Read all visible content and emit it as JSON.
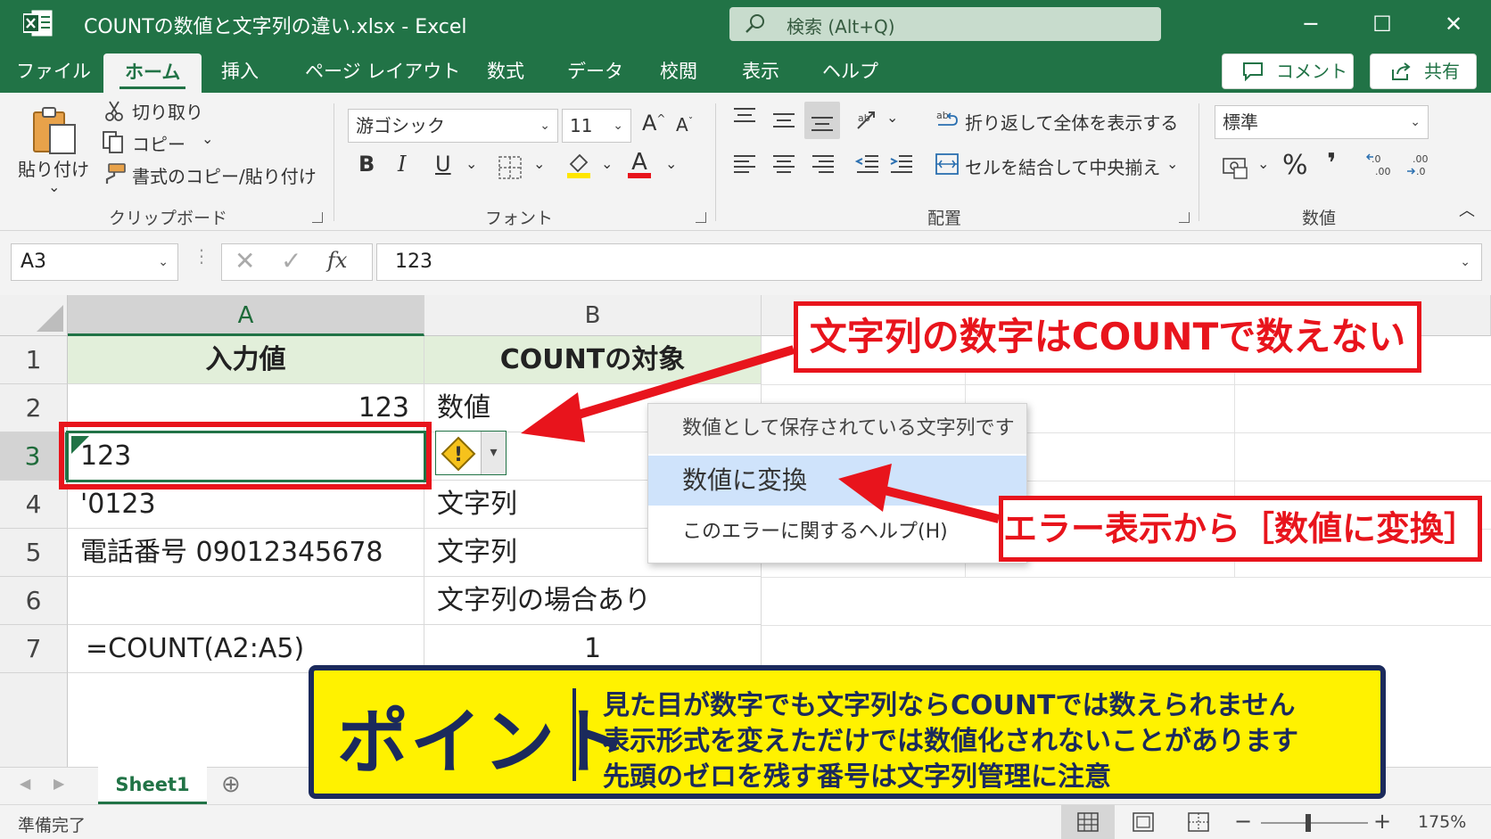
{
  "window": {
    "title": "COUNTの数値と文字列の違い.xlsx  -  Excel",
    "search_placeholder": "検索 (Alt+Q)",
    "minimize": "─",
    "maximize": "☐",
    "close": "✕"
  },
  "tabs": [
    "ファイル",
    "ホーム",
    "挿入",
    "ページ レイアウト",
    "数式",
    "データ",
    "校閲",
    "表示",
    "ヘルプ"
  ],
  "active_tab": "ホーム",
  "header_buttons": {
    "comment": "コメント",
    "share": "共有"
  },
  "ribbon": {
    "clipboard": {
      "paste": "貼り付け",
      "cut": "切り取り",
      "copy": "コピー",
      "format_painter": "書式のコピー/貼り付け",
      "label": "クリップボード"
    },
    "font": {
      "font_name": "游ゴシック",
      "font_size": "11",
      "bold": "B",
      "italic": "I",
      "underline": "U",
      "label": "フォント"
    },
    "alignment": {
      "wrap_text": "折り返して全体を表示する",
      "merge_center": "セルを結合して中央揃え",
      "label": "配置"
    },
    "number": {
      "format": "標準",
      "percent": "%",
      "comma": "❜",
      "label": "数値"
    }
  },
  "formula_bar": {
    "name_box": "A3",
    "fx": "fx",
    "formula": "123"
  },
  "columns": [
    "A",
    "B"
  ],
  "rows": [
    "1",
    "2",
    "3",
    "4",
    "5",
    "6",
    "7"
  ],
  "cells": {
    "A1": "入力値",
    "B1": "COUNTの対象",
    "A2": "123",
    "B2": "数値",
    "A3": "123",
    "B3": "",
    "A4": "'0123",
    "B4": "文字列",
    "A5": "電話番号 09012345678",
    "B5": "文字列",
    "A6": "",
    "B6": "文字列の場合あり",
    "A7": "=COUNT(A2:A5)",
    "B7": "1"
  },
  "error_menu": {
    "header": "数値として保存されている文字列です",
    "convert": "数値に変換",
    "help": "このエラーに関するヘルプ(H)"
  },
  "callouts": {
    "top": "文字列の数字はCOUNTで数えない",
    "bottom": "エラー表示から［数値に変換］"
  },
  "point": {
    "title": "ポイント",
    "lines": [
      "見た目が数字でも文字列ならCOUNTでは数えられません",
      "表示形式を変えただけでは数値化されないことがあります",
      "先頭のゼロを残す番号は文字列管理に注意"
    ]
  },
  "sheet_tab": "Sheet1",
  "status": {
    "ready": "準備完了",
    "zoom": "175%"
  },
  "colors": {
    "excel_green": "#217346",
    "callout_red": "#e8141c",
    "point_yellow": "#fff200",
    "point_navy": "#1b2a5c",
    "header_fill": "#e2efda"
  }
}
